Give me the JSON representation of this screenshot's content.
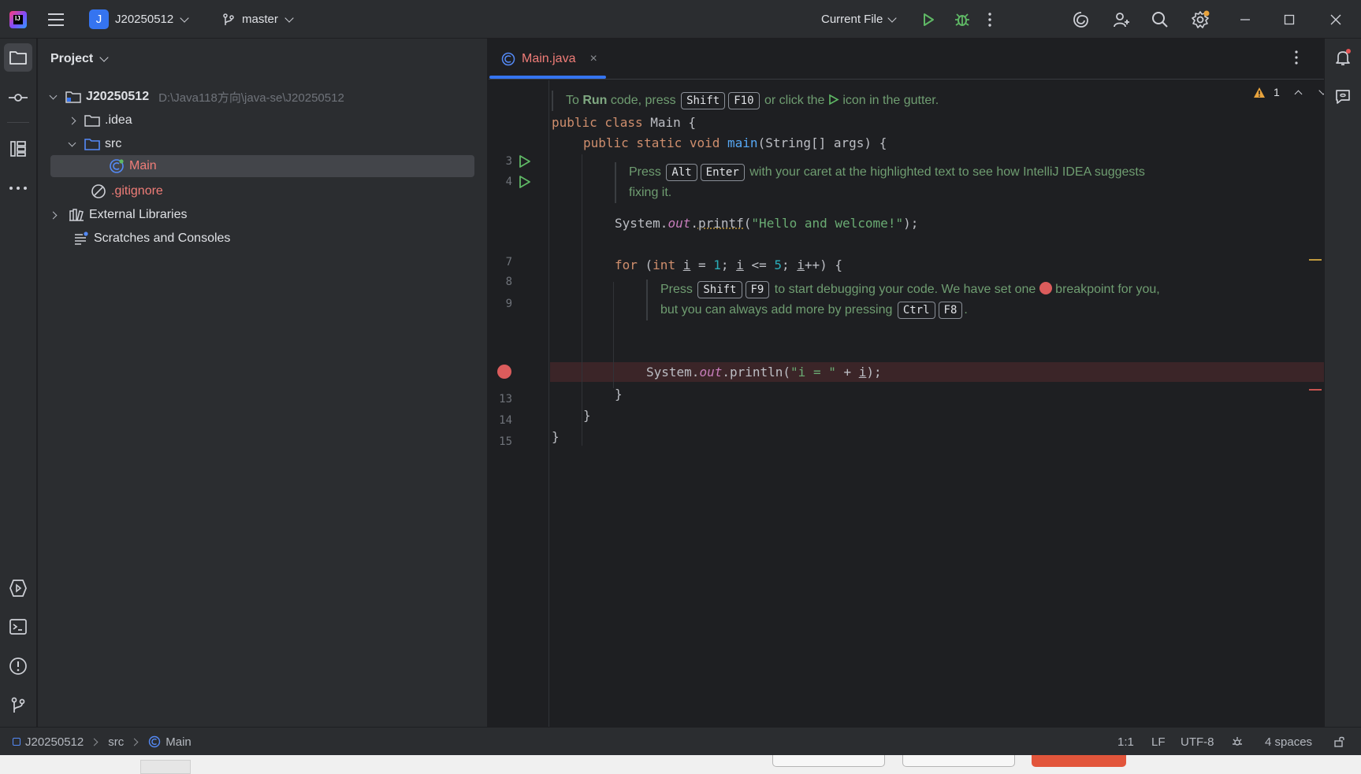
{
  "titlebar": {
    "project_initial": "J",
    "project_name": "J20250512",
    "branch": "master",
    "run_config": "Current File"
  },
  "project_panel": {
    "title": "Project",
    "tree": [
      {
        "label": "J20250512",
        "hint": "D:\\Java118方向\\java-se\\J20250512"
      },
      {
        "label": ".idea"
      },
      {
        "label": "src"
      },
      {
        "label": "Main"
      },
      {
        "label": ".gitignore"
      },
      {
        "label": "External Libraries"
      },
      {
        "label": "Scratches and Consoles"
      }
    ]
  },
  "editor": {
    "tab_label": "Main.java",
    "tab_close": "×",
    "inspection_count": "1",
    "line_numbers": [
      "3",
      "4",
      "7",
      "8",
      "9",
      "13",
      "14",
      "15"
    ],
    "hints": {
      "run": {
        "t1": "To ",
        "bold": "Run",
        "t2": " code, press ",
        "k1": "Shift",
        "k2": "F10",
        "t3": " or click the ",
        "t4": " icon in the gutter."
      },
      "alt_enter": {
        "t1": "Press ",
        "k1": "Alt",
        "k2": "Enter",
        "t2": " with your caret at the highlighted text to see how IntelliJ IDEA suggests",
        "t3": "fixing it."
      },
      "debug": {
        "t1": "Press ",
        "k1": "Shift",
        "k2": "F9",
        "t2": " to start debugging your code. We have set one ",
        "t3": " breakpoint for you,",
        "t4": "but you can always add more by pressing ",
        "k3": "Ctrl",
        "k4": "F8",
        "t5": "."
      }
    }
  },
  "statusbar": {
    "crumbs": [
      "J20250512",
      "src",
      "Main"
    ],
    "position": "1:1",
    "line_sep": "LF",
    "encoding": "UTF-8",
    "indent": "4 spaces"
  },
  "colors": {
    "accent": "#3574f0",
    "breakpoint": "#db5c5c",
    "run_green": "#5fb865"
  }
}
